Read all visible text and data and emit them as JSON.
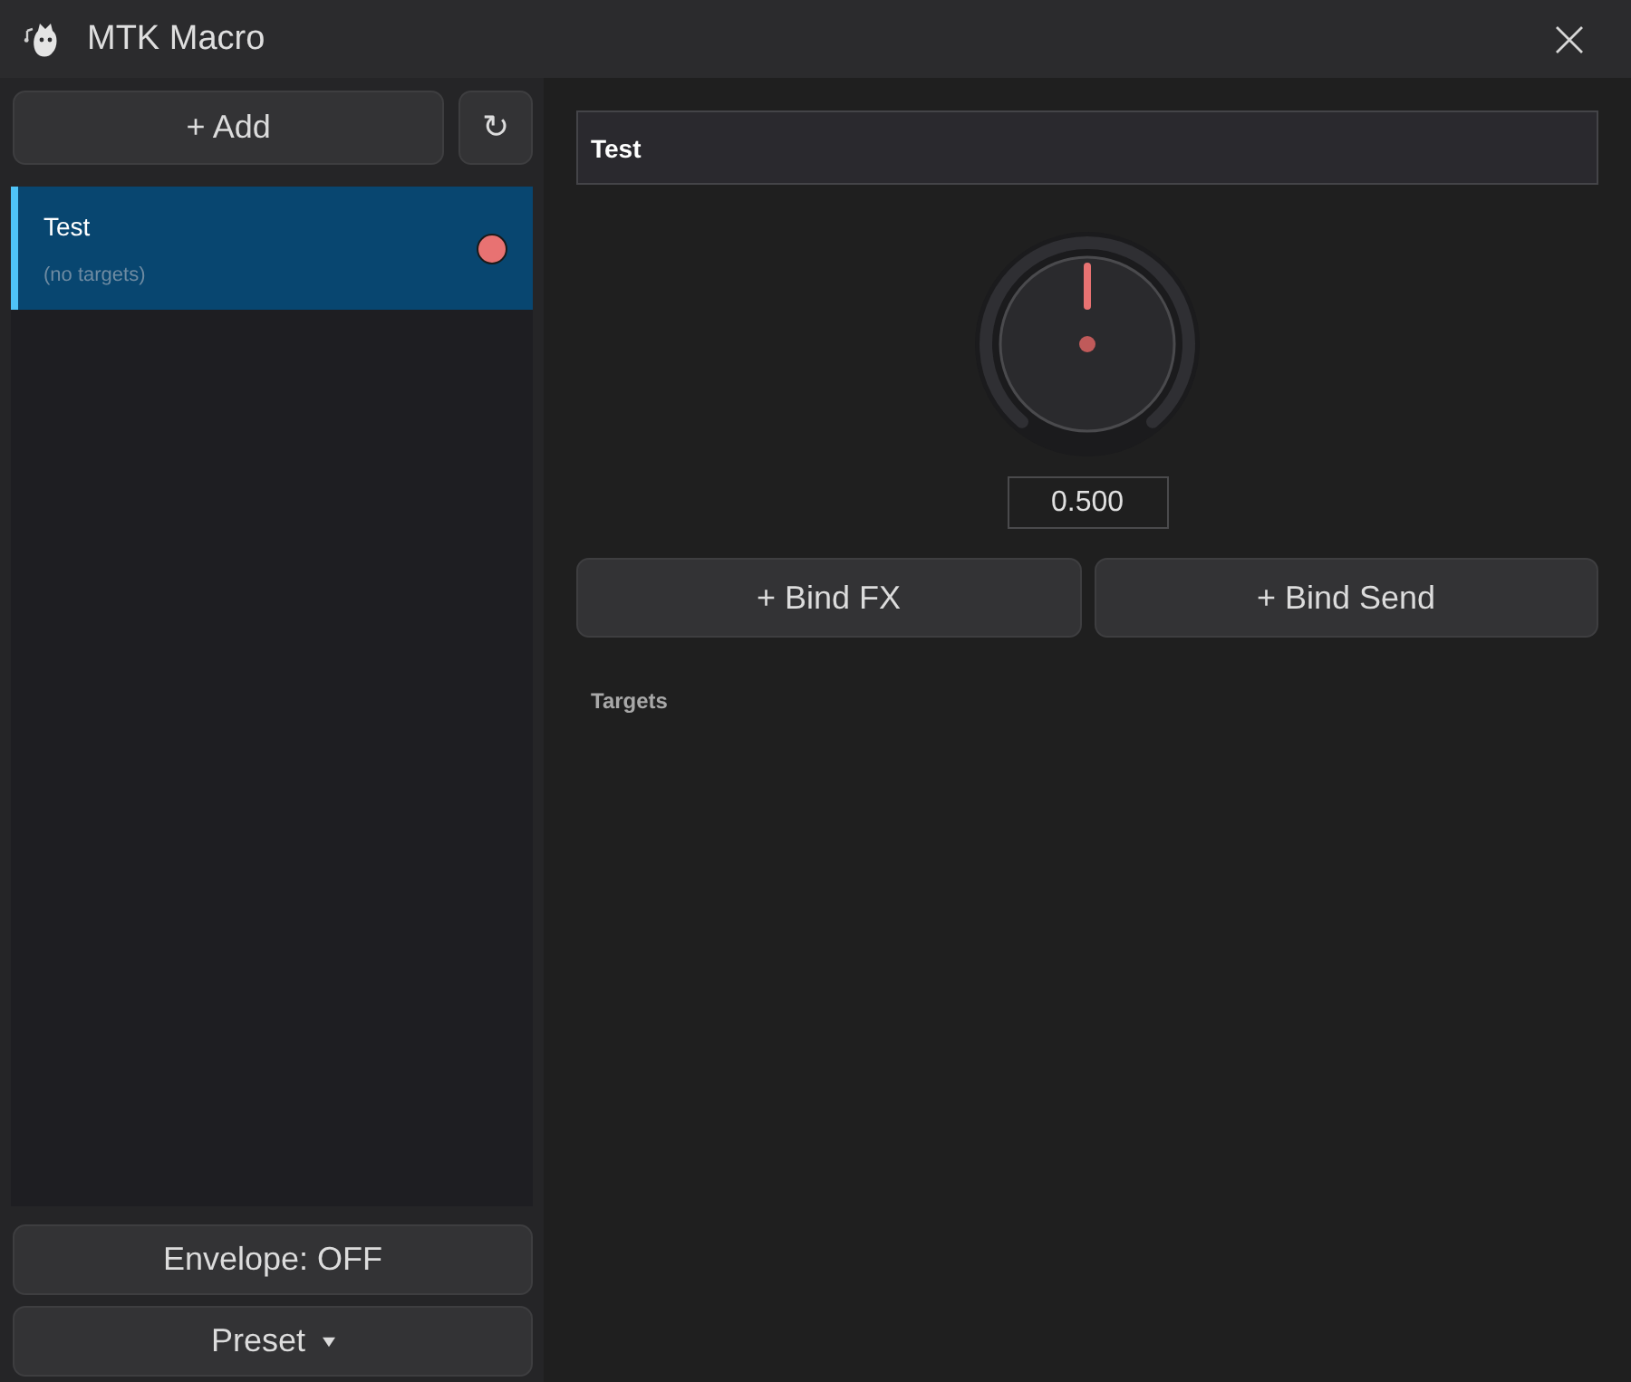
{
  "window": {
    "title": "MTK Macro"
  },
  "sidebar": {
    "add_button": "+ Add",
    "refresh_button": "↻",
    "macros": [
      {
        "name": "Test",
        "subtitle": "(no targets)",
        "selected": true,
        "color": "#e87272"
      }
    ],
    "envelope_button": "Envelope: OFF",
    "preset_button": "Preset"
  },
  "editor": {
    "name_field": {
      "value": "Test"
    },
    "knob": {
      "level": 0.5,
      "reading": "0.500"
    },
    "buttons": [
      "+ Bind FX",
      "+ Bind Send"
    ],
    "targets": {
      "heading": "Targets"
    }
  }
}
